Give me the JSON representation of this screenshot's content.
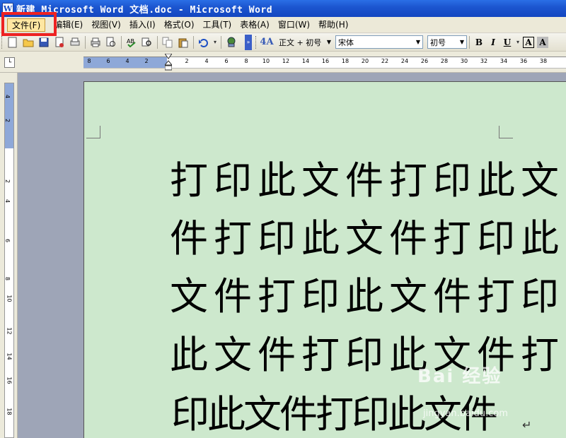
{
  "window": {
    "title": "新建 Microsoft Word 文档.doc - Microsoft Word",
    "icon": "word-app-icon"
  },
  "menu": {
    "items": [
      {
        "label": "文件(F)",
        "active": true
      },
      {
        "label": "编辑(E)"
      },
      {
        "label": "视图(V)"
      },
      {
        "label": "插入(I)"
      },
      {
        "label": "格式(O)"
      },
      {
        "label": "工具(T)"
      },
      {
        "label": "表格(A)"
      },
      {
        "label": "窗口(W)"
      },
      {
        "label": "帮助(H)"
      }
    ]
  },
  "toolbar": {
    "icons": [
      "new-document-icon",
      "open-icon",
      "save-icon",
      "permission-icon",
      "print-preview-icon",
      "print-icon",
      "print-preview-2-icon",
      "spelling-icon",
      "research-icon",
      "copy-icon",
      "paste-icon",
      "undo-icon",
      "undo-dropdown-icon",
      "hyperlink-icon"
    ],
    "style": "正文 + 初号",
    "font": "宋体",
    "size": "初号",
    "bold_label": "B",
    "italic_label": "I",
    "underline_label": "U",
    "highlight_label": "A",
    "font_color_label": "A"
  },
  "ruler": {
    "horizontal_labels": [
      "8",
      "6",
      "4",
      "2",
      "2",
      "4",
      "6",
      "8",
      "10",
      "12",
      "14",
      "16",
      "18",
      "20",
      "22",
      "24",
      "26",
      "28",
      "30",
      "32",
      "34",
      "36",
      "38"
    ],
    "vertical_labels": [
      "4",
      "2",
      "2",
      "4",
      "6",
      "8",
      "10",
      "12",
      "14",
      "16",
      "18"
    ]
  },
  "document": {
    "lines": [
      "打印此文件打印此文",
      "件打印此文件打印此",
      "文件打印此文件打印",
      "此文件打印此文件打",
      "印此文件打印此文件"
    ]
  },
  "colors": {
    "page_background": "#cde8cd",
    "highlight_box": "#ee2222",
    "title_bar": "#1c56d0"
  },
  "watermark": {
    "text": "Bai 经验",
    "sub": "jingyan.baidu.com"
  }
}
